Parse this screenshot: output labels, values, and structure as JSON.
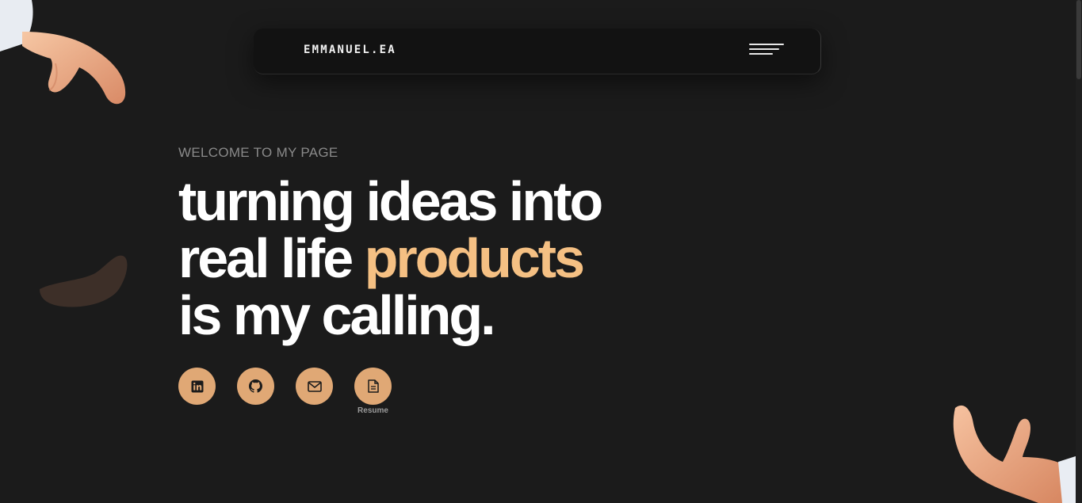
{
  "nav": {
    "brand": "EMMANUEL.EA",
    "menu_icon": "hamburger-menu-icon"
  },
  "hero": {
    "eyebrow": "WELCOME TO MY PAGE",
    "line1": "turning ideas into",
    "line2_start": "real life ",
    "line2_accent": "products",
    "line3": "is my calling."
  },
  "socials": [
    {
      "icon": "linkedin-icon",
      "label": ""
    },
    {
      "icon": "github-icon",
      "label": ""
    },
    {
      "icon": "mail-icon",
      "label": ""
    },
    {
      "icon": "document-icon",
      "label": "Resume"
    }
  ],
  "colors": {
    "background": "#1b1b1b",
    "nav_background": "#121212",
    "accent": "#f5c083",
    "button": "#e0a875"
  }
}
